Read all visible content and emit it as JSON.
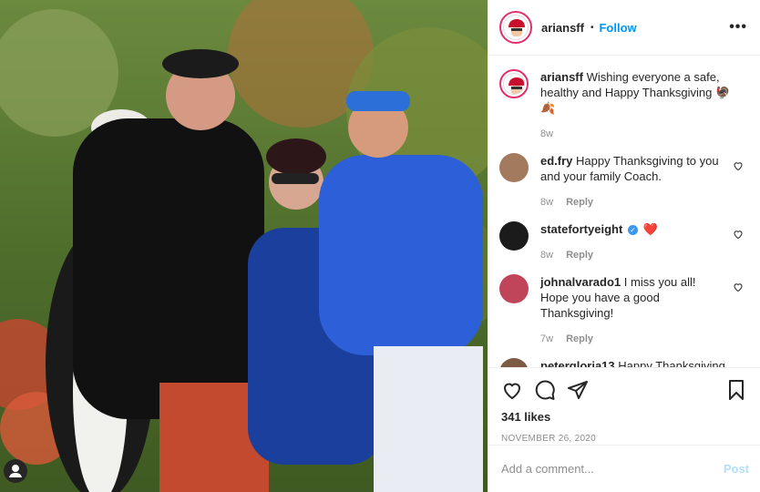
{
  "post": {
    "author": "ariansff",
    "follow_label": "Follow",
    "dot": "•",
    "more": "•••",
    "caption": "Wishing everyone a safe, healthy and Happy Thanksgiving",
    "caption_emoji": "🦃🍂",
    "caption_age": "8w",
    "likes": "341 likes",
    "date": "NOVEMBER 26, 2020"
  },
  "comments": [
    {
      "user": "ed.fry",
      "text": "Happy Thanksgiving to you and your family Coach.",
      "age": "8w",
      "reply": "Reply"
    },
    {
      "user": "statefortyeight",
      "text": "❤️",
      "age": "8w",
      "reply": "Reply",
      "verified": true
    },
    {
      "user": "johnalvarado1",
      "text": "I miss you all! Hope you have a good Thanksgiving!",
      "age": "7w",
      "reply": "Reply"
    },
    {
      "user": "petergloria13",
      "text": "Happy Thanksgiving"
    }
  ],
  "add_comment": {
    "placeholder": "Add a comment...",
    "post_label": "Post"
  },
  "colors": {
    "accent": "#0095f6",
    "muted": "#8e8e8e",
    "border": "#efefef"
  },
  "icons": [
    "heart-icon",
    "comment-icon",
    "share-icon",
    "bookmark-icon",
    "more-icon",
    "user-tag-icon"
  ]
}
